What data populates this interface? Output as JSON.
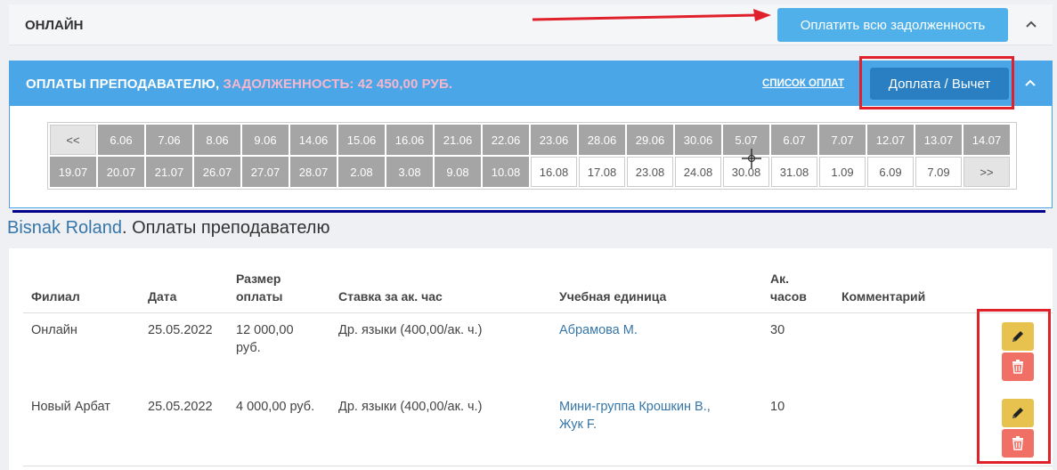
{
  "top_bar": {
    "title": "ОНЛАЙН",
    "pay_all_label": "Оплатить всю задолженность"
  },
  "panel": {
    "title": "ОПЛАТЫ ПРЕПОДАВАТЕЛЮ,",
    "debt": " ЗАДОЛЖЕННОСТЬ: 42 450,00 РУБ.",
    "payments_list_link": "СПИСОК ОПЛАТ",
    "topup_label": "Доплата / Вычет"
  },
  "dates": {
    "row1": [
      {
        "label": "<<",
        "kind": "nav"
      },
      {
        "label": "6.06",
        "kind": "done"
      },
      {
        "label": "7.06",
        "kind": "done"
      },
      {
        "label": "8.06",
        "kind": "done"
      },
      {
        "label": "9.06",
        "kind": "done"
      },
      {
        "label": "14.06",
        "kind": "done"
      },
      {
        "label": "15.06",
        "kind": "done"
      },
      {
        "label": "16.06",
        "kind": "done"
      },
      {
        "label": "21.06",
        "kind": "done"
      },
      {
        "label": "22.06",
        "kind": "done"
      },
      {
        "label": "23.06",
        "kind": "done"
      },
      {
        "label": "28.06",
        "kind": "done"
      },
      {
        "label": "29.06",
        "kind": "done"
      },
      {
        "label": "30.06",
        "kind": "done"
      },
      {
        "label": "5.07",
        "kind": "done"
      },
      {
        "label": "6.07",
        "kind": "done"
      },
      {
        "label": "7.07",
        "kind": "done"
      },
      {
        "label": "12.07",
        "kind": "done"
      },
      {
        "label": "13.07",
        "kind": "done"
      },
      {
        "label": "14.07",
        "kind": "done"
      }
    ],
    "row2": [
      {
        "label": "19.07",
        "kind": "done"
      },
      {
        "label": "20.07",
        "kind": "done"
      },
      {
        "label": "21.07",
        "kind": "done"
      },
      {
        "label": "26.07",
        "kind": "done"
      },
      {
        "label": "27.07",
        "kind": "done"
      },
      {
        "label": "28.07",
        "kind": "done"
      },
      {
        "label": "2.08",
        "kind": "done"
      },
      {
        "label": "3.08",
        "kind": "done"
      },
      {
        "label": "9.08",
        "kind": "done"
      },
      {
        "label": "10.08",
        "kind": "done"
      },
      {
        "label": "16.08",
        "kind": "open"
      },
      {
        "label": "17.08",
        "kind": "open"
      },
      {
        "label": "23.08",
        "kind": "open"
      },
      {
        "label": "24.08",
        "kind": "open"
      },
      {
        "label": "30.08",
        "kind": "open"
      },
      {
        "label": "31.08",
        "kind": "open"
      },
      {
        "label": "1.09",
        "kind": "open"
      },
      {
        "label": "6.09",
        "kind": "open"
      },
      {
        "label": "7.09",
        "kind": "open"
      },
      {
        "label": ">>",
        "kind": "nav"
      }
    ]
  },
  "heading": {
    "name": "Bisnak Roland",
    "suffix": ". Оплаты преподавателю"
  },
  "table": {
    "headers": {
      "branch": "Филиал",
      "date": "Дата",
      "amount_1": "Размер",
      "amount_2": "оплаты",
      "rate": "Ставка за ак. час",
      "unit": "Учебная единица",
      "hours_1": "Ак.",
      "hours_2": "часов",
      "comment": "Комментарий"
    },
    "rows": [
      {
        "branch": "Онлайн",
        "date": "25.05.2022",
        "amount_1": "12 000,00",
        "amount_2": "руб.",
        "rate": "Др. языки (400,00/ак. ч.)",
        "unit_1": "Абрамова М.",
        "unit_2": "",
        "hours": "30",
        "comment": ""
      },
      {
        "branch": "Новый Арбат",
        "date": "25.05.2022",
        "amount_1": "4 000,00 руб.",
        "amount_2": "",
        "rate": "Др. языки (400,00/ак. ч.)",
        "unit_1": "Мини-группа Крошкин В.,",
        "unit_2": "Жук F.",
        "hours": "10",
        "comment": ""
      }
    ]
  },
  "colors": {
    "accent": "#4aa6e6",
    "debt_text": "#f7b6cc",
    "annotation_red": "#e0202a",
    "edit": "#e8c24e",
    "delete": "#f07065"
  }
}
